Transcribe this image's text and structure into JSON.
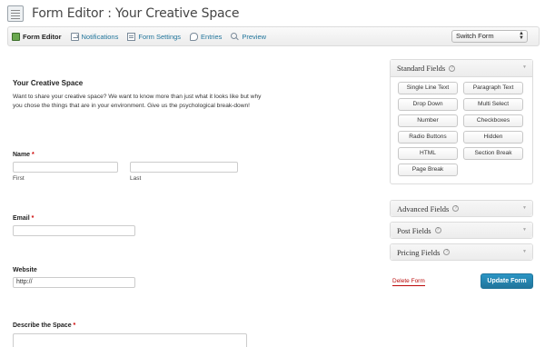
{
  "header": {
    "title": "Form Editor : Your Creative Space"
  },
  "toolbar": {
    "items": [
      {
        "label": "Form Editor",
        "icon": "form-editor-icon"
      },
      {
        "label": "Notifications",
        "icon": "notifications-icon"
      },
      {
        "label": "Form Settings",
        "icon": "form-settings-icon"
      },
      {
        "label": "Entries",
        "icon": "entries-icon"
      },
      {
        "label": "Preview",
        "icon": "preview-icon"
      }
    ],
    "switch_form": "Switch Form"
  },
  "form": {
    "title": "Your Creative Space",
    "description": "Want to share your creative space? We want to know more than just what it looks like but why you chose the things that are in your environment. Give us the psychological break-down!",
    "required_mark": "*",
    "name": {
      "label": "Name",
      "first_label": "First",
      "last_label": "Last"
    },
    "email": {
      "label": "Email"
    },
    "website": {
      "label": "Website",
      "value": "http://"
    },
    "describe": {
      "label": "Describe the Space"
    }
  },
  "sidebar": {
    "standard": {
      "title": "Standard Fields",
      "buttons": [
        "Single Line Text",
        "Paragraph Text",
        "Drop Down",
        "Multi Select",
        "Number",
        "Checkboxes",
        "Radio Buttons",
        "Hidden",
        "HTML",
        "Section Break",
        "Page Break"
      ]
    },
    "advanced": {
      "title": "Advanced Fields"
    },
    "post": {
      "title": "Post Fields"
    },
    "pricing": {
      "title": "Pricing Fields"
    },
    "help_glyph": "?",
    "arrow_glyph": "▼",
    "delete_label": "Delete Form",
    "update_label": "Update Form"
  },
  "colors": {
    "link": "#21759b",
    "delete": "#bc0b0b",
    "primary_button": "#21759b"
  }
}
